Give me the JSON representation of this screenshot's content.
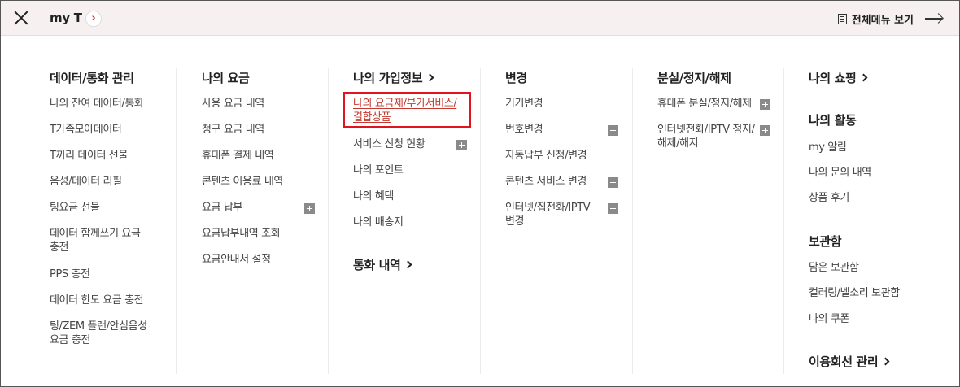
{
  "header": {
    "brand": "my T",
    "brand_arrow": "›",
    "all_menu_label": "전체메뉴 보기"
  },
  "columns": [
    {
      "heading": "데이터/통화 관리",
      "items": [
        "나의 잔여 데이터/통화",
        "T가족모아데이터",
        "T끼리 데이터 선물",
        "음성/데이터 리필",
        "팅요금 선물",
        "데이터 함께쓰기 요금",
        "충전",
        "PPS 충전",
        "데이터 한도 요금 충전",
        "팅/ZEM 플랜/안심음성",
        "요금 충전"
      ]
    },
    {
      "heading": "나의 요금",
      "items": [
        "사용 요금 내역",
        "청구 요금 내역",
        "휴대폰 결제 내역",
        "콘텐츠 이용료 내역",
        "요금 납부",
        "요금납부내역 조회",
        "요금안내서 설정"
      ]
    },
    {
      "heading": "나의 가입정보",
      "items": [
        "나의 요금제/부가서비스/",
        "결합상품",
        "서비스 신청 현황",
        "나의 포인트",
        "나의 혜택",
        "나의 배송지"
      ],
      "heading2": "통화 내역"
    },
    {
      "heading": "변경",
      "items": [
        "기기변경",
        "번호변경",
        "자동납부 신청/변경",
        "콘텐츠 서비스 변경",
        "인터넷/집전화/IPTV",
        "변경"
      ]
    },
    {
      "heading": "분실/정지/해제",
      "items": [
        "휴대폰 분실/정지/해제",
        "인터넷전화/IPTV 정지/",
        "해제/해지"
      ]
    },
    {
      "heading": "나의 쇼핑",
      "heading2": "나의 활동",
      "activity": [
        "my 알림",
        "나의 문의 내역",
        "상품 후기"
      ],
      "heading3": "보관함",
      "storage": [
        "담은 보관함",
        "컬러링/벨소리 보관함",
        "나의 쿠폰"
      ],
      "heading4": "이용회선 관리"
    }
  ],
  "colors": {
    "accent": "#e0141e",
    "link": "#c23a30"
  }
}
